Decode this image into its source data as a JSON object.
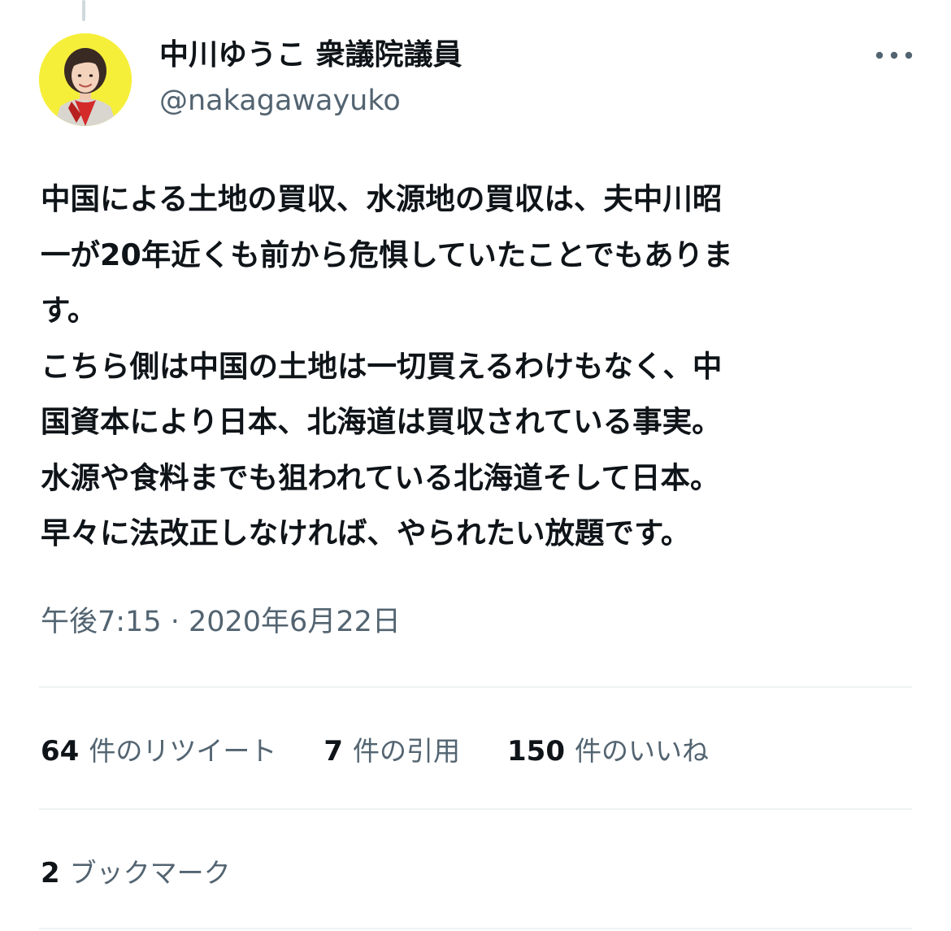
{
  "author": {
    "display_name": "中川ゆうこ 衆議院議員",
    "handle": "@nakagawayuko",
    "avatar_icon": "profile-photo",
    "avatar_bg": "#f6ef3a"
  },
  "tweet": {
    "lines": [
      "中国による土地の買収、水源地の買収は、夫中川昭",
      "一が20年近くも前から危惧していたことでもありま",
      "す。",
      "こちら側は中国の土地は一切買えるわけもなく、中",
      "国資本により日本、北海道は買収されている事実。",
      "水源や食料までも狙われている北海道そして日本。",
      "早々に法改正しなければ、やられたい放題です。"
    ],
    "timestamp": "午後7:15 · 2020年6月22日"
  },
  "stats": {
    "retweets_count": "64",
    "retweets_label": "件のリツイート",
    "quotes_count": "7",
    "quotes_label": "件の引用",
    "likes_count": "150",
    "likes_label": "件のいいね",
    "bookmarks_count": "2",
    "bookmarks_label": "ブックマーク"
  },
  "icons": {
    "more": "more-horizontal-icon"
  },
  "colors": {
    "text_primary": "#0f1419",
    "text_secondary": "#536471",
    "divider": "#eff3f4"
  }
}
